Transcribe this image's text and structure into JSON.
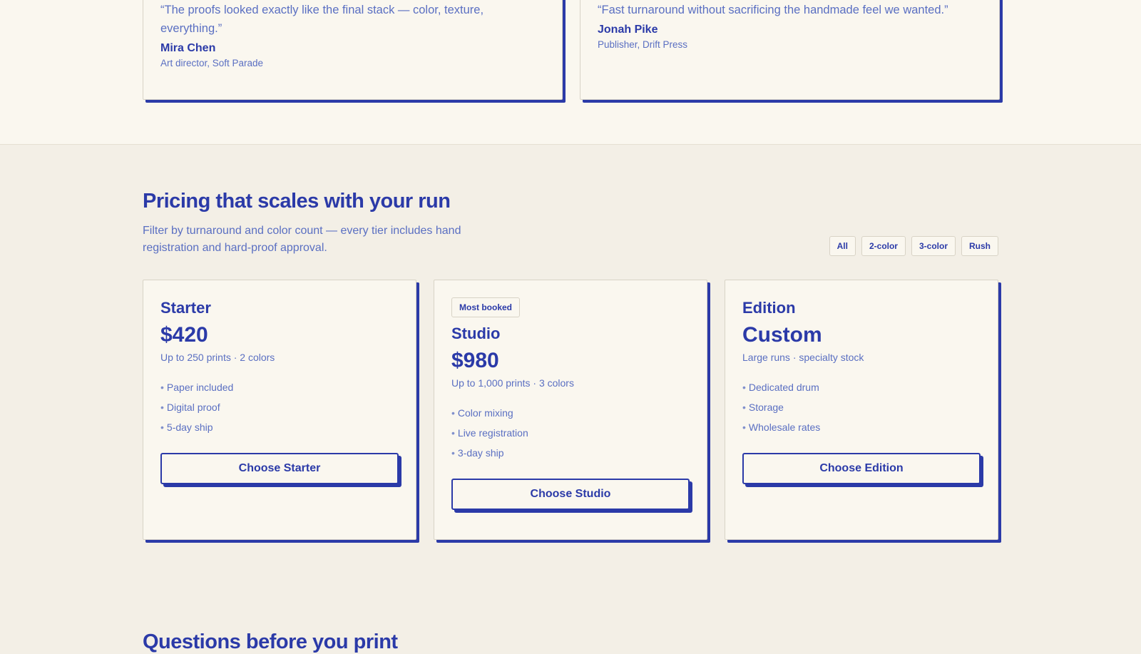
{
  "testimonials": [
    {
      "quote": "“The proofs looked exactly like the final stack — color, texture, everything.”",
      "author": "Mira Chen",
      "role": "Art director, Soft Parade"
    },
    {
      "quote": "“Fast turnaround without sacrificing the handmade feel we wanted.”",
      "author": "Jonah Pike",
      "role": "Publisher, Drift Press"
    }
  ],
  "pricing": {
    "title": "Pricing that scales with your run",
    "subtitle": "Filter by turnaround and color count — every tier includes hand registration and hard-proof approval.",
    "filters": [
      "All",
      "2-color",
      "3-color",
      "Rush"
    ],
    "plans": [
      {
        "name": "Starter",
        "price": "$420",
        "desc": "Up to 250 prints · 2 colors",
        "features": [
          "Paper included",
          "Digital proof",
          "5-day ship"
        ],
        "cta": "Choose Starter"
      },
      {
        "badge": "Most booked",
        "name": "Studio",
        "price": "$980",
        "desc": "Up to 1,000 prints · 3 colors",
        "features": [
          "Color mixing",
          "Live registration",
          "3-day ship"
        ],
        "cta": "Choose Studio"
      },
      {
        "name": "Edition",
        "price": "Custom",
        "desc": "Large runs · specialty stock",
        "features": [
          "Dedicated drum",
          "Storage",
          "Wholesale rates"
        ],
        "cta": "Choose Edition"
      }
    ]
  },
  "faq": {
    "title": "Questions before you print"
  },
  "colors": {
    "accent": "#2b3aa8",
    "muted": "#5a6fc2",
    "card_bg": "#faf7ef",
    "section_bg": "#f3efe6"
  }
}
